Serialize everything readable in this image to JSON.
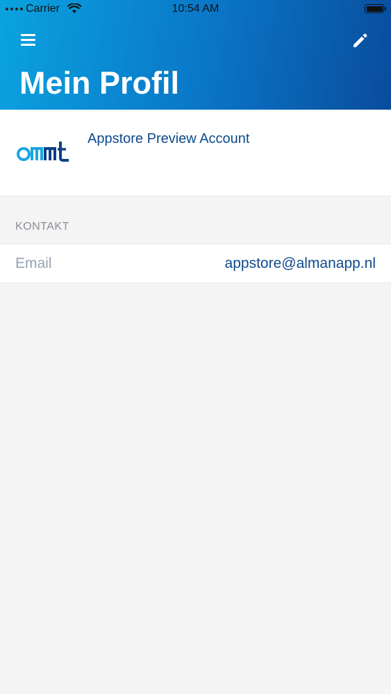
{
  "status_bar": {
    "carrier": "Carrier",
    "time": "10:54 AM"
  },
  "header": {
    "title": "Mein Profil",
    "menu_icon": "hamburger-menu-icon",
    "edit_icon": "pencil-icon",
    "gradient_colors": [
      "#0aa3e0",
      "#0a4c9c"
    ]
  },
  "profile": {
    "logo_text": "omt",
    "account_name": "Appstore Preview Account"
  },
  "contact_section": {
    "header": "KONTAKT",
    "rows": [
      {
        "label": "Email",
        "value": "appstore@almanapp.nl"
      }
    ]
  },
  "colors": {
    "accent": "#0d4a8b",
    "label_gray": "#93a2b2",
    "background": "#f4f4f5"
  }
}
